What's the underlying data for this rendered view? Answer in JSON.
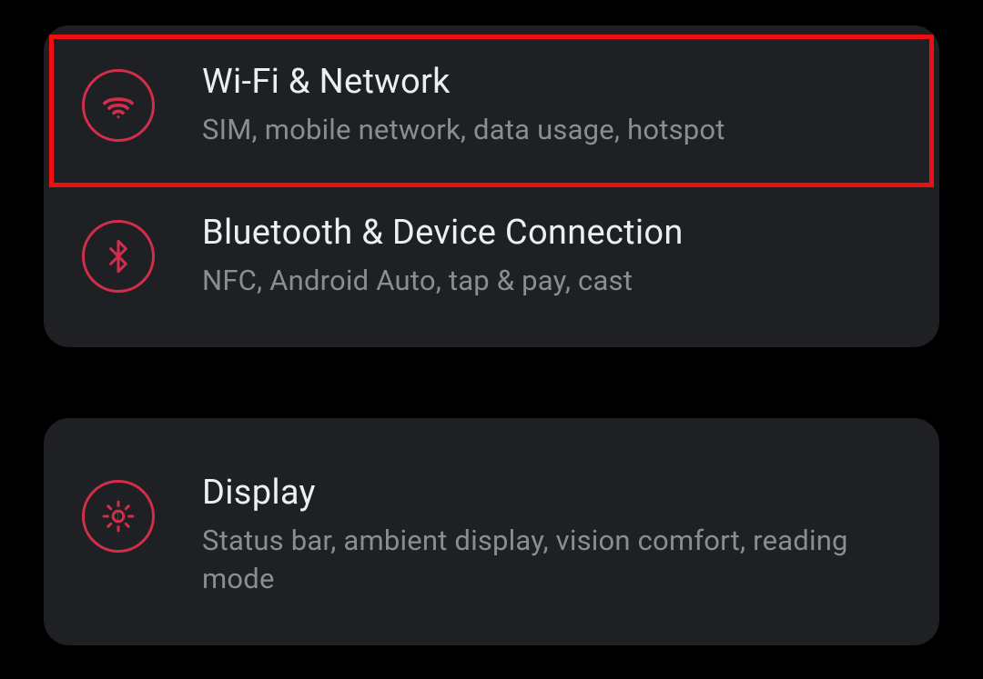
{
  "settings": {
    "groups": [
      {
        "items": [
          {
            "id": "wifi",
            "title": "Wi-Fi & Network",
            "subtitle": "SIM, mobile network, data usage, hotspot",
            "icon": "wifi-icon",
            "highlighted": true
          },
          {
            "id": "bluetooth",
            "title": "Bluetooth & Device Connection",
            "subtitle": "NFC, Android Auto, tap & pay, cast",
            "icon": "bluetooth-icon",
            "highlighted": false
          }
        ]
      },
      {
        "items": [
          {
            "id": "display",
            "title": "Display",
            "subtitle": "Status bar, ambient display, vision comfort, reading mode",
            "icon": "brightness-icon",
            "highlighted": false
          }
        ]
      }
    ]
  },
  "colors": {
    "accent": "#d22e4c",
    "highlight": "#ee1010",
    "card_bg": "#1e2023",
    "title_text": "#eceef0",
    "subtitle_text": "#8a8d91"
  }
}
